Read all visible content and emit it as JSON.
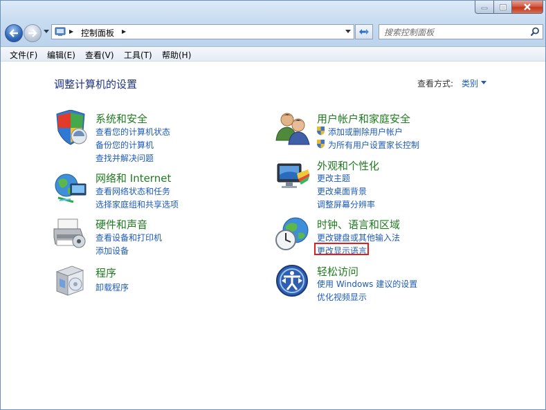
{
  "address": {
    "segment": "控制面板"
  },
  "search": {
    "placeholder": "搜索控制面板"
  },
  "menu": [
    "文件(F)",
    "编辑(E)",
    "查看(V)",
    "工具(T)",
    "帮助(H)"
  ],
  "page_title": "调整计算机的设置",
  "view": {
    "label": "查看方式:",
    "value": "类别"
  },
  "categories": [
    {
      "title": "系统和安全",
      "links": [
        "查看您的计算机状态",
        "备份您的计算机",
        "查找并解决问题"
      ]
    },
    {
      "title": "网络和 Internet",
      "links": [
        "查看网络状态和任务",
        "选择家庭组和共享选项"
      ]
    },
    {
      "title": "硬件和声音",
      "links": [
        "查看设备和打印机",
        "添加设备"
      ]
    },
    {
      "title": "程序",
      "links": [
        "卸载程序"
      ]
    },
    {
      "title": "用户帐户和家庭安全",
      "links": [
        "添加或删除用户帐户",
        "为所有用户设置家长控制"
      ]
    },
    {
      "title": "外观和个性化",
      "links": [
        "更改主题",
        "更改桌面背景",
        "调整屏幕分辨率"
      ]
    },
    {
      "title": "时钟、语言和区域",
      "links": [
        "更改键盘或其他输入法",
        "更改显示语言"
      ]
    },
    {
      "title": "轻松访问",
      "links": [
        "使用 Windows 建议的设置",
        "优化视频显示"
      ]
    }
  ],
  "colors": {
    "category_title": "#1e7b1e",
    "link": "#1e5bb8",
    "page_title": "#1e3287",
    "highlight": "#e21d1d"
  }
}
